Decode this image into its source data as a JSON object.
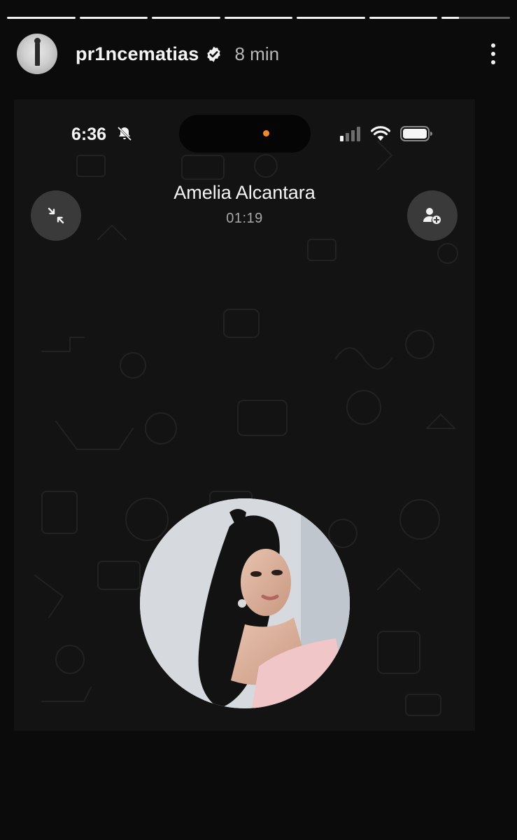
{
  "story": {
    "progress_segments": [
      1,
      1,
      1,
      1,
      1,
      1,
      0.25
    ],
    "username": "pr1ncematias",
    "verified": true,
    "posted_ago": "8 min",
    "avatar_icon": "profile-photo",
    "more_icon": "more-vertical-icon"
  },
  "phone": {
    "status_bar": {
      "time": "6:36",
      "silent_icon": "bell-slash-icon",
      "signal_icon": "cellular-signal-icon",
      "wifi_icon": "wifi-icon",
      "battery_icon": "battery-icon"
    },
    "call": {
      "contact_name": "Amelia Alcantara",
      "duration": "01:19",
      "minimize_icon": "minimize-arrows-icon",
      "add_participant_icon": "add-person-icon"
    }
  },
  "colors": {
    "background": "#0b0b0b",
    "screen_background": "#131313",
    "button_background": "#3a3a3a",
    "island_dot": "#f18a2b"
  }
}
